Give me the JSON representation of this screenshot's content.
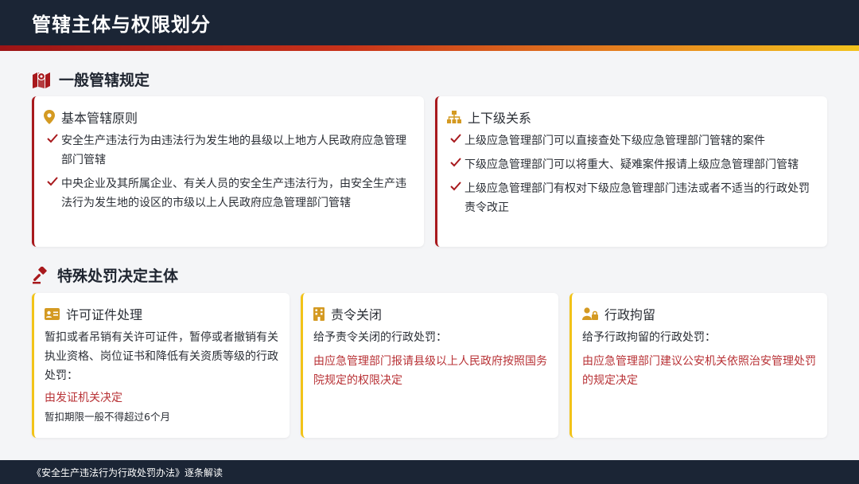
{
  "header": {
    "title": "管辖主体与权限划分"
  },
  "section1": {
    "title": "一般管辖规定",
    "left_card": {
      "title": "基本管辖原则",
      "items": [
        "安全生产违法行为由违法行为发生地的县级以上地方人民政府应急管理部门管辖",
        "中央企业及其所属企业、有关人员的安全生产违法行为，由安全生产违法行为发生地的设区的市级以上人民政府应急管理部门管辖"
      ]
    },
    "right_card": {
      "title": "上下级关系",
      "items": [
        "上级应急管理部门可以直接查处下级应急管理部门管辖的案件",
        "下级应急管理部门可以将重大、疑难案件报请上级应急管理部门管辖",
        "上级应急管理部门有权对下级应急管理部门违法或者不适当的行政处罚责令改正"
      ]
    }
  },
  "section2": {
    "title": "特殊处罚决定主体",
    "cards": [
      {
        "title": "许可证件处理",
        "body": "暂扣或者吊销有关许可证件，暂停或者撤销有关执业资格、岗位证书和降低有关资质等级的行政处罚：",
        "highlight": "由发证机关决定",
        "note": "暂扣期限一般不得超过6个月"
      },
      {
        "title": "责令关闭",
        "body": "给予责令关闭的行政处罚：",
        "highlight": "由应急管理部门报请县级以上人民政府按照国务院规定的权限决定"
      },
      {
        "title": "行政拘留",
        "body": "给予行政拘留的行政处罚：",
        "highlight": "由应急管理部门建议公安机关依照治安管理处罚的规定决定"
      }
    ]
  },
  "footer": {
    "text": "《安全生产违法行为行政处罚办法》逐条解读"
  },
  "colors": {
    "dark": "#1b2535",
    "red": "#a8191d",
    "yellow": "#f2c318",
    "gold": "#d49a22"
  }
}
